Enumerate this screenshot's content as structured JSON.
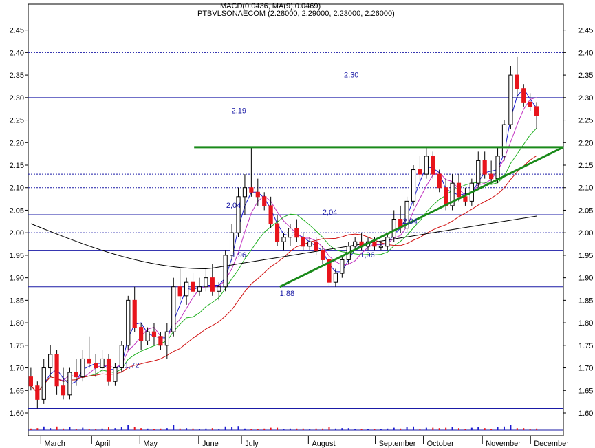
{
  "chart_data": {
    "type": "candlestick",
    "header": {
      "indicator_text": "MACD(0.0436, MA(9),0.0469)",
      "ticker_text": "PTBVLSONAECOM (2.28000, 2.29000, 2.23000, 2.26000)"
    },
    "ohlc_last": {
      "open": 2.28,
      "high": 2.29,
      "low": 2.23,
      "close": 2.26
    },
    "y_range": [
      1.6,
      2.48
    ],
    "y_ticks": [
      "1.60",
      "1.65",
      "1.70",
      "1.75",
      "1.80",
      "1.85",
      "1.90",
      "1.95",
      "2.00",
      "2.05",
      "2.10",
      "2.15",
      "2.20",
      "2.25",
      "2.30",
      "2.35",
      "2.40",
      "2.45"
    ],
    "months": [
      "March",
      "April",
      "May",
      "June",
      "July",
      "August",
      "September",
      "October",
      "November",
      "December"
    ],
    "price_levels": [
      {
        "value": 2.3,
        "style": "solid",
        "label": "2,30",
        "label_x": 0.59,
        "label_y": 2.345
      },
      {
        "value": 2.4,
        "style": "dotted",
        "label": "",
        "label_x": 0,
        "label_y": 0
      },
      {
        "value": 2.13,
        "style": "dotted",
        "label": "",
        "label_x": 0,
        "label_y": 0
      },
      {
        "value": 2.1,
        "style": "dotted",
        "label": "",
        "label_x": 0,
        "label_y": 0
      },
      {
        "value": 2.04,
        "style": "solid",
        "label": "2,04",
        "label_x": 0.7,
        "label_y": 2.02
      },
      {
        "value": 2.0,
        "style": "dotted",
        "label": "",
        "label_x": 0,
        "label_y": 0
      },
      {
        "value": 1.96,
        "style": "solid",
        "label": "1,96",
        "label_x": 0.62,
        "label_y": 1.945
      },
      {
        "value": 1.88,
        "style": "solid",
        "label": "1,88",
        "label_x": 0.47,
        "label_y": 1.86
      },
      {
        "value": 1.72,
        "style": "solid",
        "label": "1,72",
        "label_x": 0.18,
        "label_y": 1.7
      },
      {
        "value": 1.61,
        "style": "solid",
        "label": "",
        "label_x": 0,
        "label_y": 0
      }
    ],
    "extra_labels": [
      {
        "text": "2,19",
        "value": 2.265,
        "pos": 0.38
      },
      {
        "text": "2,04",
        "value": 2.055,
        "pos": 0.37
      },
      {
        "text": "2,04",
        "value": 2.04,
        "pos": 0.55
      },
      {
        "text": "1,96",
        "value": 1.945,
        "pos": 0.38
      }
    ],
    "trend_lines": [
      {
        "name": "resistance",
        "from": [
          0.31,
          2.19
        ],
        "to": [
          1.0,
          2.19
        ],
        "color": "#1a8a1a"
      },
      {
        "name": "support",
        "from": [
          0.47,
          1.88
        ],
        "to": [
          1.0,
          2.19
        ],
        "color": "#1a8a1a"
      }
    ],
    "candles": [
      [
        1.68,
        1.7,
        1.65,
        1.66
      ],
      [
        1.66,
        1.67,
        1.61,
        1.63
      ],
      [
        1.63,
        1.72,
        1.62,
        1.7
      ],
      [
        1.7,
        1.75,
        1.68,
        1.73
      ],
      [
        1.73,
        1.74,
        1.64,
        1.66
      ],
      [
        1.66,
        1.7,
        1.63,
        1.64
      ],
      [
        1.64,
        1.7,
        1.63,
        1.69
      ],
      [
        1.69,
        1.72,
        1.66,
        1.68
      ],
      [
        1.68,
        1.74,
        1.67,
        1.72
      ],
      [
        1.72,
        1.77,
        1.7,
        1.71
      ],
      [
        1.71,
        1.73,
        1.68,
        1.7
      ],
      [
        1.7,
        1.74,
        1.69,
        1.72
      ],
      [
        1.72,
        1.73,
        1.66,
        1.67
      ],
      [
        1.67,
        1.71,
        1.66,
        1.7
      ],
      [
        1.7,
        1.76,
        1.69,
        1.75
      ],
      [
        1.75,
        1.86,
        1.74,
        1.85
      ],
      [
        1.85,
        1.88,
        1.78,
        1.79
      ],
      [
        1.79,
        1.8,
        1.74,
        1.76
      ],
      [
        1.76,
        1.79,
        1.75,
        1.78
      ],
      [
        1.78,
        1.8,
        1.75,
        1.77
      ],
      [
        1.77,
        1.78,
        1.74,
        1.75
      ],
      [
        1.75,
        1.8,
        1.72,
        1.78
      ],
      [
        1.78,
        1.9,
        1.77,
        1.88
      ],
      [
        1.88,
        1.92,
        1.85,
        1.86
      ],
      [
        1.86,
        1.9,
        1.84,
        1.89
      ],
      [
        1.89,
        1.91,
        1.86,
        1.87
      ],
      [
        1.87,
        1.9,
        1.86,
        1.88
      ],
      [
        1.88,
        1.92,
        1.87,
        1.9
      ],
      [
        1.9,
        1.93,
        1.86,
        1.87
      ],
      [
        1.87,
        1.89,
        1.85,
        1.88
      ],
      [
        1.88,
        1.96,
        1.87,
        1.95
      ],
      [
        1.95,
        2.02,
        1.94,
        2.0
      ],
      [
        2.0,
        2.1,
        1.99,
        2.08
      ],
      [
        2.08,
        2.13,
        2.04,
        2.1
      ],
      [
        2.1,
        2.19,
        2.08,
        2.09
      ],
      [
        2.09,
        2.12,
        2.06,
        2.08
      ],
      [
        2.08,
        2.09,
        2.05,
        2.06
      ],
      [
        2.06,
        2.08,
        2.01,
        2.02
      ],
      [
        2.02,
        2.04,
        1.97,
        1.98
      ],
      [
        1.98,
        2.0,
        1.96,
        1.99
      ],
      [
        1.99,
        2.02,
        1.97,
        2.01
      ],
      [
        2.01,
        2.03,
        1.98,
        1.99
      ],
      [
        1.99,
        2.0,
        1.96,
        1.97
      ],
      [
        1.97,
        1.99,
        1.96,
        1.98
      ],
      [
        1.98,
        1.99,
        1.95,
        1.96
      ],
      [
        1.96,
        1.97,
        1.93,
        1.94
      ],
      [
        1.94,
        1.95,
        1.88,
        1.89
      ],
      [
        1.89,
        1.92,
        1.88,
        1.91
      ],
      [
        1.91,
        1.95,
        1.9,
        1.94
      ],
      [
        1.94,
        1.98,
        1.93,
        1.97
      ],
      [
        1.97,
        1.99,
        1.96,
        1.98
      ],
      [
        1.98,
        2.0,
        1.96,
        1.97
      ],
      [
        1.97,
        1.99,
        1.96,
        1.98
      ],
      [
        1.98,
        1.99,
        1.96,
        1.97
      ],
      [
        1.97,
        1.98,
        1.96,
        1.97
      ],
      [
        1.97,
        2.0,
        1.96,
        1.99
      ],
      [
        1.99,
        2.05,
        1.98,
        2.03
      ],
      [
        2.03,
        2.06,
        2.0,
        2.01
      ],
      [
        2.01,
        2.08,
        2.0,
        2.07
      ],
      [
        2.07,
        2.15,
        2.06,
        2.14
      ],
      [
        2.14,
        2.17,
        2.11,
        2.13
      ],
      [
        2.13,
        2.19,
        2.12,
        2.17
      ],
      [
        2.17,
        2.18,
        2.12,
        2.13
      ],
      [
        2.13,
        2.14,
        2.09,
        2.1
      ],
      [
        2.1,
        2.12,
        2.05,
        2.06
      ],
      [
        2.06,
        2.13,
        2.05,
        2.11
      ],
      [
        2.11,
        2.13,
        2.07,
        2.08
      ],
      [
        2.08,
        2.1,
        2.06,
        2.07
      ],
      [
        2.07,
        2.12,
        2.06,
        2.11
      ],
      [
        2.11,
        2.18,
        2.1,
        2.16
      ],
      [
        2.16,
        2.18,
        2.12,
        2.13
      ],
      [
        2.13,
        2.16,
        2.11,
        2.12
      ],
      [
        2.12,
        2.19,
        2.11,
        2.17
      ],
      [
        2.17,
        2.25,
        2.16,
        2.24
      ],
      [
        2.24,
        2.37,
        2.23,
        2.35
      ],
      [
        2.35,
        2.39,
        2.3,
        2.32
      ],
      [
        2.32,
        2.33,
        2.28,
        2.29
      ],
      [
        2.29,
        2.31,
        2.27,
        2.28
      ],
      [
        2.28,
        2.29,
        2.23,
        2.26
      ]
    ]
  }
}
